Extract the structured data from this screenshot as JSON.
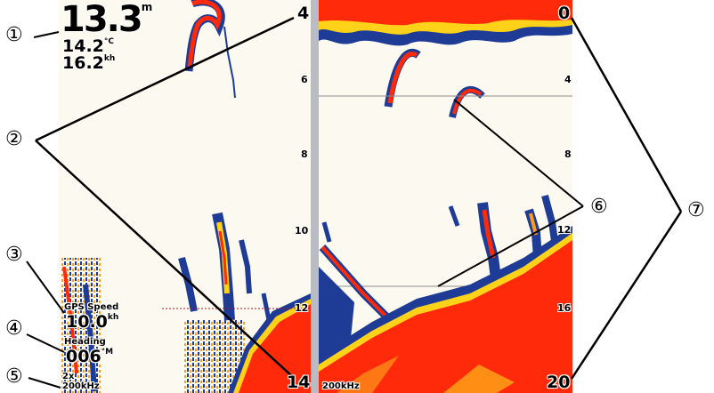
{
  "left_panel": {
    "depth": {
      "value": "13.3",
      "unit": "m"
    },
    "water_temp": {
      "value": "14.2",
      "unit": "°C"
    },
    "speed": {
      "value": "16.2",
      "unit": "kh"
    },
    "depth_scale": {
      "top": "4",
      "ticks": [
        "6",
        "8",
        "10",
        "12"
      ],
      "bottom": "14"
    },
    "gps_speed": {
      "label": "GPS Speed",
      "value": "10.0",
      "unit": "kh"
    },
    "heading": {
      "label": "Heading",
      "value": "006",
      "unit": "°M"
    },
    "zoom": "2x",
    "frequency": "200kHz"
  },
  "right_panel": {
    "depth_scale": {
      "top": "0",
      "ticks": [
        "4",
        "8",
        "12",
        "16"
      ],
      "bottom": "20"
    },
    "frequency": "200kHz"
  },
  "callouts": [
    "①",
    "②",
    "③",
    "④",
    "⑤",
    "⑥",
    "⑦"
  ],
  "colors": {
    "pane_background": "#fcfaf0",
    "sonar_red": "#ff2a0a",
    "sonar_blue": "#1e3c96",
    "divider": "#b9bcc4"
  }
}
